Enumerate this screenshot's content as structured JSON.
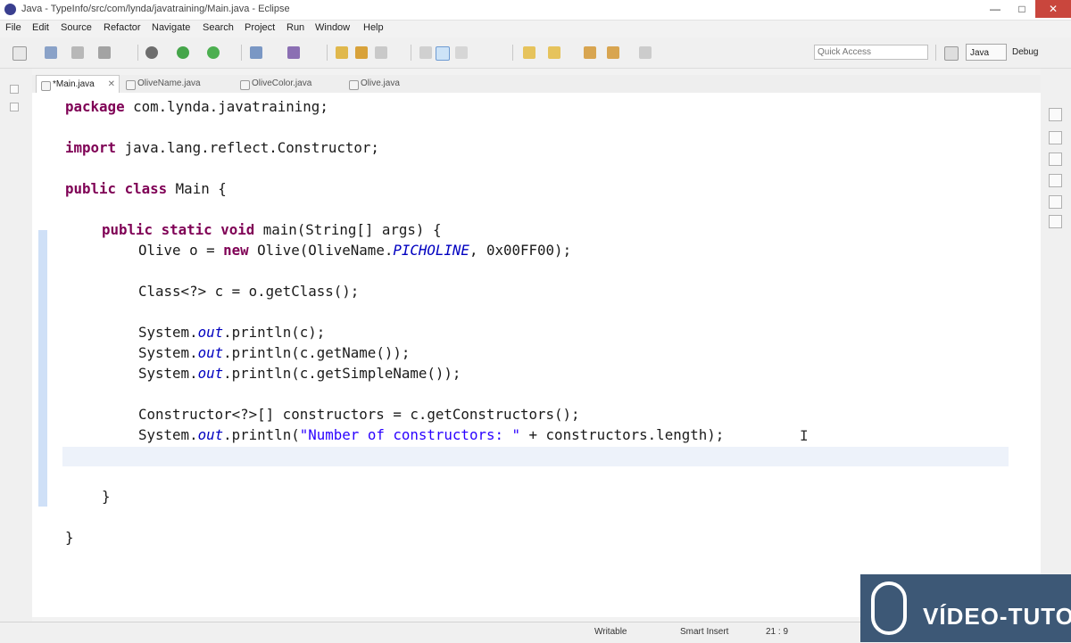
{
  "window": {
    "title": "Java - TypeInfo/src/com/lynda/javatraining/Main.java - Eclipse",
    "minimize": "—",
    "maximize": "□",
    "close": "✕"
  },
  "menu": [
    "File",
    "Edit",
    "Source",
    "Refactor",
    "Navigate",
    "Search",
    "Project",
    "Run",
    "Window",
    "Help"
  ],
  "toolbar": {
    "quick_access_placeholder": "Quick Access",
    "perspective_java": "Java",
    "perspective_debug": "Debug"
  },
  "tabs": [
    {
      "label": "*Main.java",
      "close": "✕"
    },
    {
      "label": "OliveName.java"
    },
    {
      "label": "OliveColor.java"
    },
    {
      "label": "Olive.java"
    }
  ],
  "code": {
    "line1": {
      "kw": "package",
      "rest": " com.lynda.javatraining;"
    },
    "line2": {
      "kw": "import",
      "rest": " java.lang.reflect.Constructor;"
    },
    "line3": {
      "kw1": "public",
      "kw2": "class",
      "rest": " Main {"
    },
    "line4": {
      "kw1": "public",
      "kw2": "static",
      "kw3": "void",
      "rest": " main(String[] args) {"
    },
    "line5": {
      "a": "Olive o = ",
      "kw": "new",
      "b": " Olive(OliveName.",
      "it": "PICHOLINE",
      "c": ", 0x00FF00);"
    },
    "line6": "Class<?> c = o.getClass();",
    "line7": {
      "a": "System.",
      "it": "out",
      "b": ".println(c);"
    },
    "line8": {
      "a": "System.",
      "it": "out",
      "b": ".println(c.getName());"
    },
    "line9": {
      "a": "System.",
      "it": "out",
      "b": ".println(c.getSimpleName());"
    },
    "line10": "Constructor<?>[] constructors = c.getConstructors();",
    "line11": {
      "a": "System.",
      "it": "out",
      "b": ".println(",
      "str": "\"Number of constructors: \"",
      "c": " + constructors.length);"
    },
    "line12": "}",
    "line13": "}"
  },
  "status": {
    "writable": "Writable",
    "insert_mode": "Smart Insert",
    "position": "21 : 9"
  },
  "watermark": {
    "text": "VÍDEO-TUTOR"
  }
}
